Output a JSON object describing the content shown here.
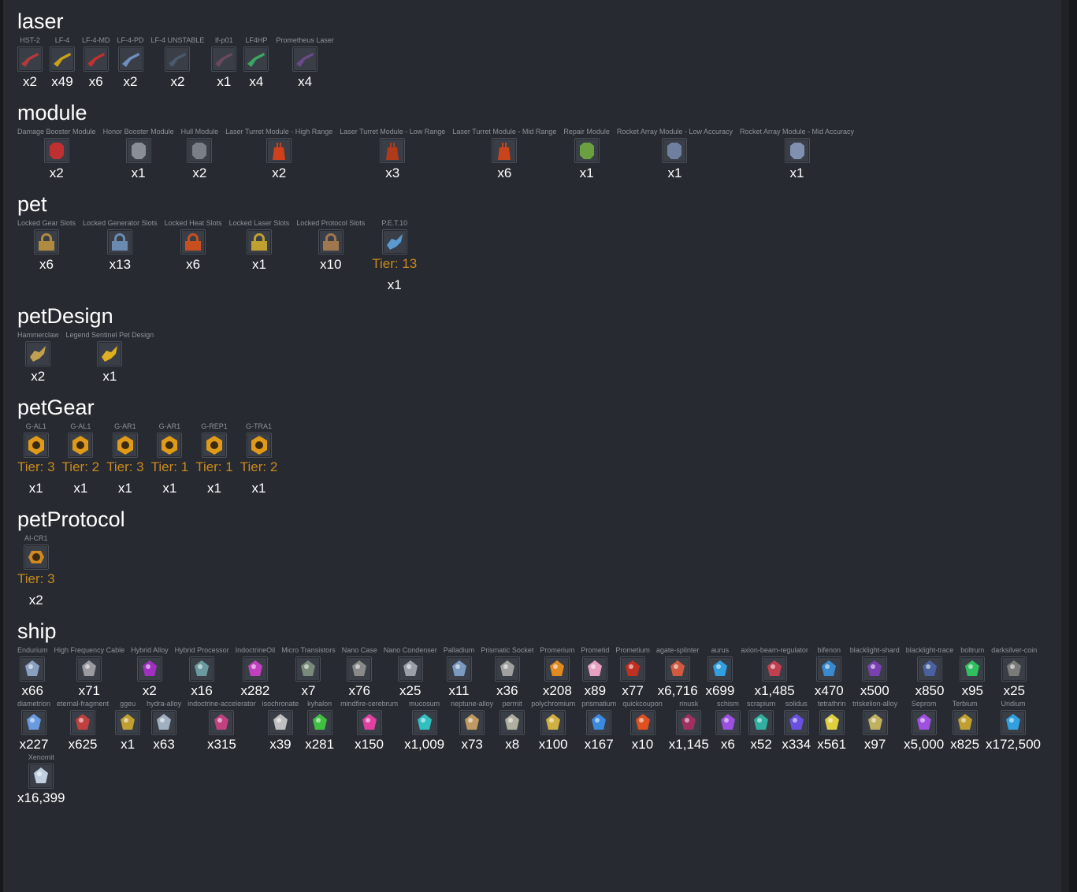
{
  "colors": {
    "background": "#272a30",
    "title": "#ffffff",
    "label": "#8e939a",
    "tier": "#c98a1d",
    "qty": "#ffffff"
  },
  "sections": [
    {
      "title": "laser",
      "items": [
        {
          "name": "HST-2",
          "qty": "x2",
          "icon": "laser-icon",
          "color": "#b33a3a"
        },
        {
          "name": "LF-4",
          "qty": "x49",
          "icon": "laser-icon",
          "color": "#c9a21b"
        },
        {
          "name": "LF-4-MD",
          "qty": "x6",
          "icon": "laser-icon",
          "color": "#c23030"
        },
        {
          "name": "LF-4-PD",
          "qty": "x2",
          "icon": "laser-icon",
          "color": "#6f8fc0"
        },
        {
          "name": "LF-4 UNSTABLE",
          "qty": "x2",
          "icon": "laser-icon",
          "color": "#4a5a6a"
        },
        {
          "name": "lf-p01",
          "qty": "x1",
          "icon": "laser-icon",
          "color": "#6a4a5a"
        },
        {
          "name": "LF4HP",
          "qty": "x4",
          "icon": "laser-icon",
          "color": "#3aa860"
        },
        {
          "name": "Prometheus Laser",
          "qty": "x4",
          "icon": "laser-icon",
          "color": "#6a4a8a"
        }
      ]
    },
    {
      "title": "module",
      "items": [
        {
          "name": "Damage Booster Module",
          "qty": "x2",
          "icon": "module-icon",
          "color": "#c03030"
        },
        {
          "name": "Honor Booster Module",
          "qty": "x1",
          "icon": "module-icon",
          "color": "#8a8f96"
        },
        {
          "name": "Hull Module",
          "qty": "x2",
          "icon": "module-icon",
          "color": "#7a7f86"
        },
        {
          "name": "Laser Turret Module - High Range",
          "qty": "x2",
          "icon": "turret-icon",
          "color": "#d0401a"
        },
        {
          "name": "Laser Turret Module - Low Range",
          "qty": "x3",
          "icon": "turret-icon",
          "color": "#b03a1a"
        },
        {
          "name": "Laser Turret Module - Mid Range",
          "qty": "x6",
          "icon": "turret-icon",
          "color": "#c8451c"
        },
        {
          "name": "Repair Module",
          "qty": "x1",
          "icon": "module-icon",
          "color": "#6aa040"
        },
        {
          "name": "Rocket Array Module - Low Accuracy",
          "qty": "x1",
          "icon": "module-icon",
          "color": "#6f7fa0"
        },
        {
          "name": "Rocket Array Module - Mid Accuracy",
          "qty": "x1",
          "icon": "module-icon",
          "color": "#8090b0"
        }
      ]
    },
    {
      "title": "pet",
      "items": [
        {
          "name": "Locked Gear Slots",
          "qty": "x6",
          "icon": "lock-icon",
          "color": "#b08a40"
        },
        {
          "name": "Locked Generator Slots",
          "qty": "x13",
          "icon": "lock-icon",
          "color": "#6a8ab0"
        },
        {
          "name": "Locked Heat Slots",
          "qty": "x6",
          "icon": "lock-icon",
          "color": "#c85020"
        },
        {
          "name": "Locked Laser Slots",
          "qty": "x1",
          "icon": "lock-icon",
          "color": "#c0a030"
        },
        {
          "name": "Locked Protocol Slots",
          "qty": "x10",
          "icon": "lock-icon",
          "color": "#a07850"
        },
        {
          "name": "P.E.T.10",
          "tier": "Tier: 13",
          "qty": "x1",
          "icon": "pet-icon",
          "color": "#5a9ad0"
        }
      ]
    },
    {
      "title": "petDesign",
      "items": [
        {
          "name": "Hammerclaw",
          "qty": "x2",
          "icon": "pet-design-icon",
          "color": "#c0a050"
        },
        {
          "name": "Legend Sentinel Pet Design",
          "qty": "x1",
          "icon": "pet-design-icon",
          "color": "#e0b020"
        }
      ]
    },
    {
      "title": "petGear",
      "items": [
        {
          "name": "G-AL1",
          "tier": "Tier: 3",
          "qty": "x1",
          "icon": "gear-icon",
          "color": "#e09a18"
        },
        {
          "name": "G-AL1",
          "tier": "Tier: 2",
          "qty": "x1",
          "icon": "gear-icon",
          "color": "#e09a18"
        },
        {
          "name": "G-AR1",
          "tier": "Tier: 3",
          "qty": "x1",
          "icon": "gear-icon",
          "color": "#e09a18"
        },
        {
          "name": "G-AR1",
          "tier": "Tier: 1",
          "qty": "x1",
          "icon": "gear-icon",
          "color": "#e09a18"
        },
        {
          "name": "G-REP1",
          "tier": "Tier: 1",
          "qty": "x1",
          "icon": "wrench-icon",
          "color": "#e09a18"
        },
        {
          "name": "G-TRA1",
          "tier": "Tier: 2",
          "qty": "x1",
          "icon": "gear-icon",
          "color": "#e09a18"
        }
      ]
    },
    {
      "title": "petProtocol",
      "items": [
        {
          "name": "AI-CR1",
          "tier": "Tier: 3",
          "qty": "x2",
          "icon": "protocol-chip-icon",
          "color": "#d08a20"
        }
      ]
    },
    {
      "title": "ship",
      "items": [
        {
          "name": "Endurium",
          "qty": "x66",
          "icon": "resource-icon",
          "color": "#8aa0c0"
        },
        {
          "name": "High Frequency Cable",
          "qty": "x71",
          "icon": "resource-icon",
          "color": "#9a9aa0"
        },
        {
          "name": "Hybrid Alloy",
          "qty": "x2",
          "icon": "resource-icon",
          "color": "#a030c0"
        },
        {
          "name": "Hybrid Processor",
          "qty": "x16",
          "icon": "resource-icon",
          "color": "#6a9aa0"
        },
        {
          "name": "IndoctrineOil",
          "qty": "x282",
          "icon": "resource-icon",
          "color": "#c040c0"
        },
        {
          "name": "Micro Transistors",
          "qty": "x7",
          "icon": "resource-icon",
          "color": "#7a8a7a"
        },
        {
          "name": "Nano Case",
          "qty": "x76",
          "icon": "resource-icon",
          "color": "#8a8a8a"
        },
        {
          "name": "Nano Condenser",
          "qty": "x25",
          "icon": "resource-icon",
          "color": "#9aa0a8"
        },
        {
          "name": "Palladium",
          "qty": "x11",
          "icon": "resource-icon",
          "color": "#7a9ac0"
        },
        {
          "name": "Prismatic Socket",
          "qty": "x36",
          "icon": "resource-icon",
          "color": "#a0a0a0"
        },
        {
          "name": "Promerium",
          "qty": "x208",
          "icon": "resource-icon",
          "color": "#e08a20"
        },
        {
          "name": "Prometid",
          "qty": "x89",
          "icon": "resource-icon",
          "color": "#e8a0c0"
        },
        {
          "name": "Prometium",
          "qty": "x77",
          "icon": "resource-icon",
          "color": "#c03020"
        },
        {
          "name": "agate-splinter",
          "qty": "x6,716",
          "icon": "resource-icon",
          "color": "#d05a40"
        },
        {
          "name": "aurus",
          "qty": "x699",
          "icon": "resource-icon",
          "color": "#30a0e0"
        },
        {
          "name": "axion-beam-regulator",
          "qty": "x1,485",
          "icon": "resource-icon",
          "color": "#c04050"
        },
        {
          "name": "bifenon",
          "qty": "x470",
          "icon": "resource-icon",
          "color": "#3a8ad0"
        },
        {
          "name": "blacklight-shard",
          "qty": "x500",
          "icon": "resource-icon",
          "color": "#7a40b0"
        },
        {
          "name": "blacklight-trace",
          "qty": "x850",
          "icon": "resource-icon",
          "color": "#4a60a0"
        },
        {
          "name": "boltrum",
          "qty": "x95",
          "icon": "resource-icon",
          "color": "#30c060"
        },
        {
          "name": "darksilver-coin",
          "qty": "x25",
          "icon": "resource-icon",
          "color": "#7a7a7a"
        },
        {
          "name": "diametrion",
          "qty": "x227",
          "icon": "resource-icon",
          "color": "#6a9ae0"
        },
        {
          "name": "eternal-fragment",
          "qty": "x625",
          "icon": "resource-icon",
          "color": "#c04040"
        },
        {
          "name": "ggeu",
          "qty": "x1",
          "icon": "resource-icon",
          "color": "#c0a030"
        },
        {
          "name": "hydra-alloy",
          "qty": "x63",
          "icon": "resource-icon",
          "color": "#a0b0c0"
        },
        {
          "name": "indoctrine-accelerator",
          "qty": "x315",
          "icon": "resource-icon",
          "color": "#c04080"
        },
        {
          "name": "isochronate",
          "qty": "x39",
          "icon": "resource-icon",
          "color": "#c0c0c0"
        },
        {
          "name": "kyhalon",
          "qty": "x281",
          "icon": "resource-icon",
          "color": "#40c040"
        },
        {
          "name": "mindfire-cerebrum",
          "qty": "x150",
          "icon": "resource-icon",
          "color": "#e040a0"
        },
        {
          "name": "mucosum",
          "qty": "x1,009",
          "icon": "resource-icon",
          "color": "#30c0c0"
        },
        {
          "name": "neptune-alloy",
          "qty": "x73",
          "icon": "resource-icon",
          "color": "#c09a60"
        },
        {
          "name": "permit",
          "qty": "x8",
          "icon": "resource-icon",
          "color": "#b0b0a0"
        },
        {
          "name": "polychromium",
          "qty": "x100",
          "icon": "resource-icon",
          "color": "#d0b040"
        },
        {
          "name": "prismatium",
          "qty": "x167",
          "icon": "resource-icon",
          "color": "#3a8ae0"
        },
        {
          "name": "quickcoupon",
          "qty": "x10",
          "icon": "resource-icon",
          "color": "#e05020"
        },
        {
          "name": "rinusk",
          "qty": "x1,145",
          "icon": "resource-icon",
          "color": "#a03060"
        },
        {
          "name": "schism",
          "qty": "x6",
          "icon": "resource-icon",
          "color": "#9a50e0"
        },
        {
          "name": "scrapium",
          "qty": "x52",
          "icon": "resource-icon",
          "color": "#30b0a0"
        },
        {
          "name": "solidus",
          "qty": "x334",
          "icon": "resource-icon",
          "color": "#6a50e0"
        },
        {
          "name": "tetrathrin",
          "qty": "x561",
          "icon": "resource-icon",
          "color": "#e0d040"
        },
        {
          "name": "triskelion-alloy",
          "qty": "x97",
          "icon": "resource-icon",
          "color": "#c0b060"
        },
        {
          "name": "Seprom",
          "qty": "x5,000",
          "icon": "resource-icon",
          "color": "#a050e0"
        },
        {
          "name": "Terbium",
          "qty": "x825",
          "icon": "resource-icon",
          "color": "#c0a030"
        },
        {
          "name": "Uridium",
          "qty": "x172,500",
          "icon": "resource-icon",
          "color": "#30a0e0"
        },
        {
          "name": "Xenomit",
          "qty": "x16,399",
          "icon": "resource-icon",
          "color": "#c0d0e0"
        }
      ]
    }
  ]
}
